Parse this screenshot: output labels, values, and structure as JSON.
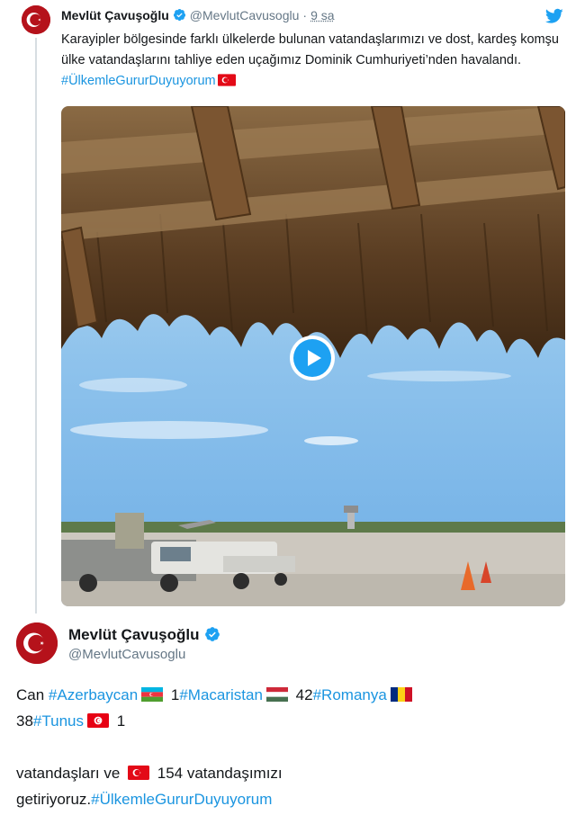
{
  "tweet1": {
    "name": "Mevlüt Çavuşoğlu",
    "handle": "@MevlutCavusoglu",
    "separator": "·",
    "time": "9 sa",
    "text_plain": "Karayipler bölgesinde farklı ülkelerde bulunan vatandaşlarımızı ve dost, kardeş komşu ülke vatandaşlarını tahliye eden uçağımız Dominik Cumhuriyeti’nden havalandı. ",
    "hashtag": "#ÜlkemleGururDuyuyorum",
    "icons": {
      "avatar": "turkish-flag-avatar",
      "verified": "verified-badge-icon",
      "twitter": "twitter-bird-icon",
      "play": "play-icon"
    },
    "video": {
      "description_colors": {
        "sky": "#8fc3ec",
        "thatch": "#6b4a26",
        "tarmac": "#cdc8bf"
      }
    }
  },
  "tweet2": {
    "name": "Mevlüt Çavuşoğlu",
    "handle": "@MevlutCavusoglu",
    "line1": {
      "prefix": "Can ",
      "tag_azerbaycan": "#Azerbaycan",
      "count_az": " 1",
      "tag_macaristan": "#Macaristan",
      "count_hu": " 42",
      "tag_romanya": "#Romanya"
    },
    "line2": {
      "count_ro": "38",
      "tag_tunus": "#Tunus",
      "count_tn": " 1"
    },
    "line3": {
      "prefix": "vatandaşları ve ",
      "suffix": " 154 vatandaşımızı"
    },
    "line4": {
      "prefix": "getiriyoruz.",
      "hashtag": "#ÜlkemleGururDuyuyorum"
    }
  },
  "colors": {
    "text": "#14171a",
    "muted": "#657786",
    "link": "#1b95e0",
    "twitter_blue": "#1da1f2",
    "flag_red": "#e30a17"
  }
}
